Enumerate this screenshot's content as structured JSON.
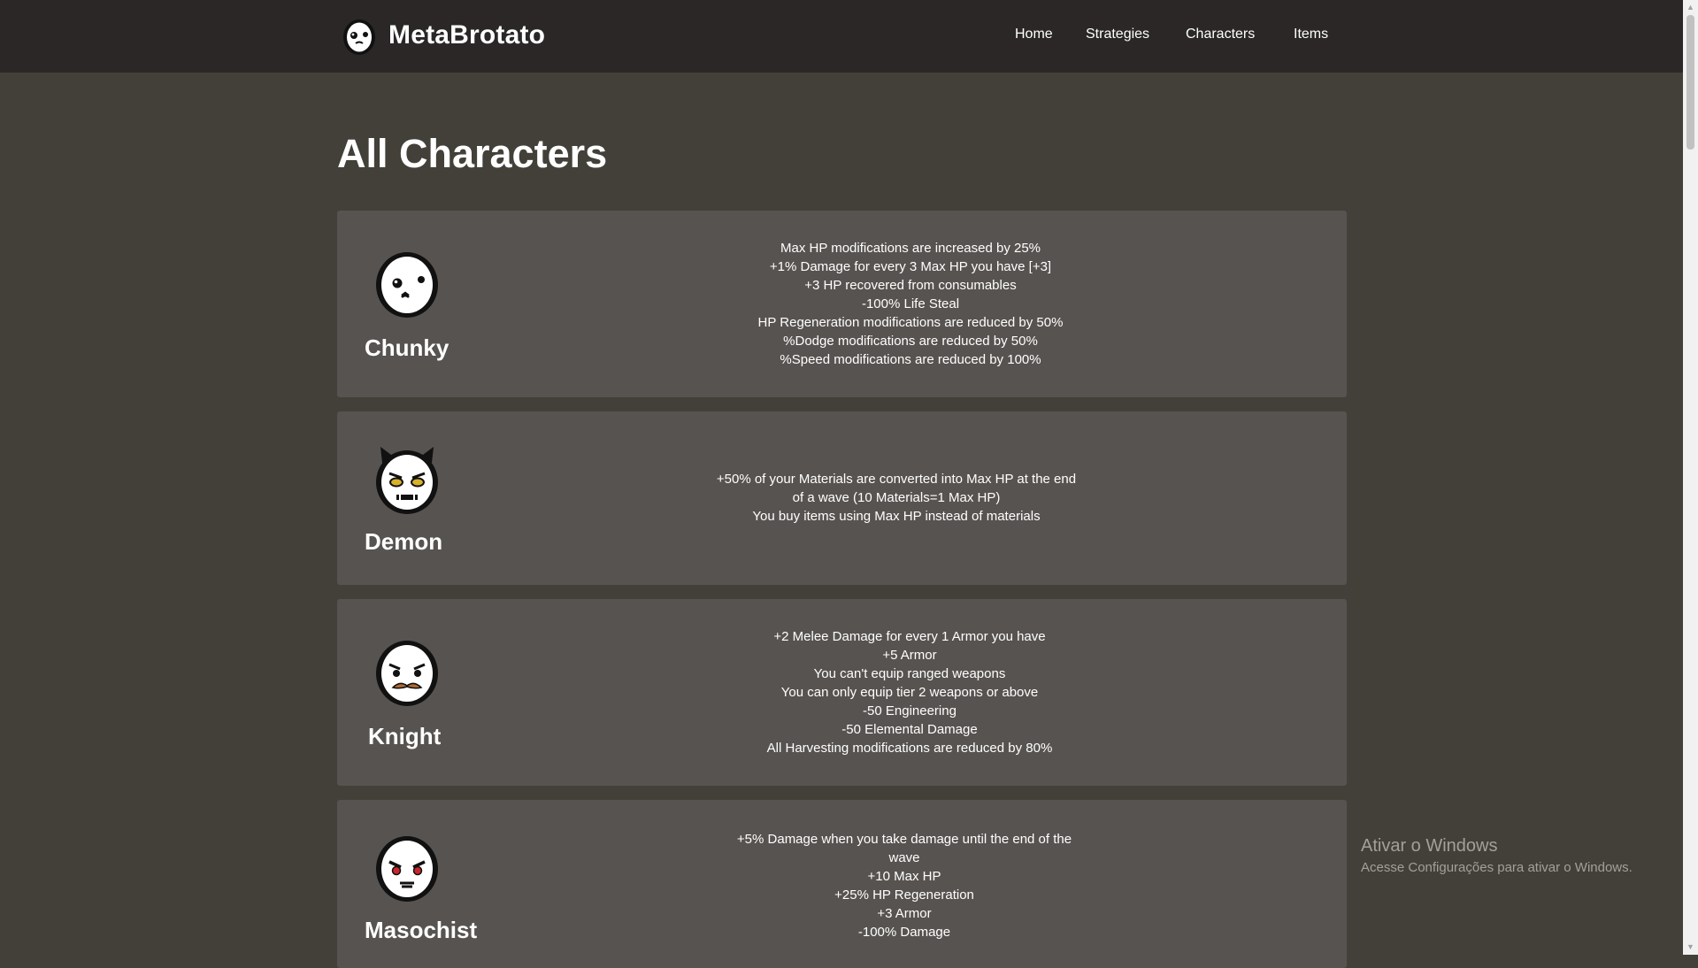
{
  "brand": {
    "name": "MetaBrotato"
  },
  "nav": [
    {
      "label": "Home"
    },
    {
      "label": "Strategies"
    },
    {
      "label": "Characters"
    },
    {
      "label": "Items"
    }
  ],
  "page": {
    "title": "All Characters"
  },
  "characters": [
    {
      "name": "Chunky",
      "traits": [
        "Max HP modifications are increased by 25%",
        "+1% Damage for every 3 Max HP you have [+3]",
        "+3 HP recovered from consumables",
        "-100% Life Steal",
        "HP Regeneration modifications are reduced by 50%",
        "%Dodge modifications are reduced by 50%",
        "%Speed modifications are reduced by 100%"
      ]
    },
    {
      "name": "Demon",
      "traits": [
        "+50% of your Materials are converted into Max HP at the end of a wave (10 Materials=1 Max HP)",
        "You buy items using Max HP instead of materials"
      ]
    },
    {
      "name": "Knight",
      "traits": [
        "+2 Melee Damage for every 1 Armor you have",
        "+5 Armor",
        "You can't equip ranged weapons",
        "You can only equip tier 2 weapons or above",
        "-50 Engineering",
        "-50 Elemental Damage",
        "All Harvesting modifications are reduced by 80%"
      ]
    },
    {
      "name": "Masochist",
      "traits": [
        "+5% Damage when you take damage until the end of the wave",
        "+10 Max HP",
        "+25% HP Regeneration",
        "+3 Armor",
        "-100% Damage"
      ]
    }
  ],
  "watermark": {
    "title": "Ativar o Windows",
    "subtitle": "Acesse Configurações para ativar o Windows."
  },
  "colors": {
    "page_bg": "#434039",
    "topbar_bg": "#2a2726",
    "card_bg": "#575350",
    "demon_eyes": "#d8b12a",
    "knight_mustache": "#b06a35",
    "masochist_eyes": "#c9252a"
  }
}
